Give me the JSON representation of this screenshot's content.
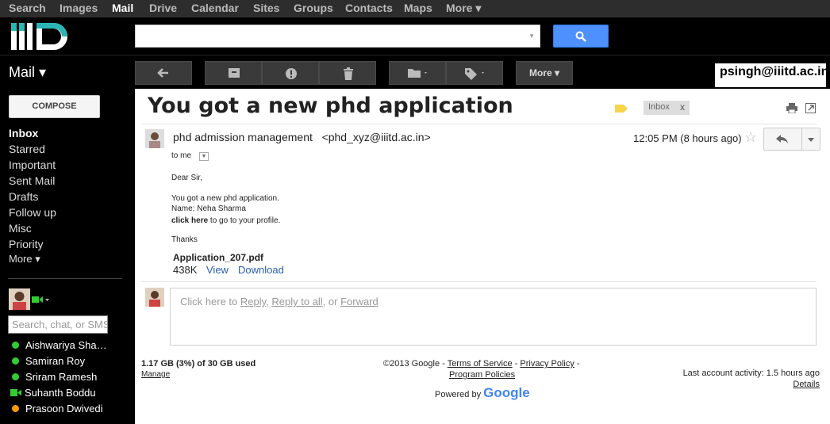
{
  "topnav": {
    "items": [
      "Search",
      "Images",
      "Mail",
      "Drive",
      "Calendar",
      "Sites",
      "Groups",
      "Contacts",
      "Maps",
      "More ▾"
    ]
  },
  "header": {
    "logo_text": "IIITD",
    "search_value": "",
    "search_caret": "▼"
  },
  "toolbar": {
    "mail_label": "Mail ▾",
    "more_label": "More ▾",
    "account_email": "psingh@iiitd.ac.in"
  },
  "sidebar": {
    "compose_label": "COMPOSE",
    "nav": [
      "Inbox",
      "Starred",
      "Important",
      "Sent Mail",
      "Drafts",
      "Follow up",
      "Misc",
      "Priority",
      "More ▾"
    ],
    "chat_search_placeholder": "Search, chat, or SMS",
    "contacts": [
      {
        "name": "Aishwariya Sha…",
        "status": "available"
      },
      {
        "name": "Samiran Roy",
        "status": "available"
      },
      {
        "name": "Sriram Ramesh",
        "status": "available"
      },
      {
        "name": "Suhanth Boddu",
        "status": "video"
      },
      {
        "name": "Prasoon Dwivedi",
        "status": "idle"
      }
    ],
    "status_colors": {
      "available": "#3c3",
      "idle": "#f90",
      "video": "#3c3"
    }
  },
  "message": {
    "subject": "You got a new phd application",
    "label": "Inbox",
    "label_close": "x",
    "sender_name": "phd admission management",
    "sender_email": "<phd_xyz@iiitd.ac.in>",
    "time": "12:05 PM (8 hours ago)",
    "to_line": "to me",
    "body": {
      "greeting": "Dear Sir,",
      "line1": "You got a new phd application.",
      "line2": "Name: Neha Sharma",
      "link_text": "click here",
      "link_suffix": " to go to your profile.",
      "signoff": "Thanks"
    },
    "attachment": {
      "name": "Application_207.pdf",
      "size": "438K",
      "view": "View",
      "download": "Download"
    }
  },
  "reply_box": {
    "prefix": "Click here to ",
    "reply": "Reply",
    "sep1": ", ",
    "reply_all": "Reply to all",
    "sep2": ", or ",
    "forward": "Forward"
  },
  "footer": {
    "storage": "1.17 GB (3%) of 30 GB used",
    "manage": "Manage",
    "copyright": "©2013 Google - ",
    "terms": "Terms of Service",
    "dash1": " - ",
    "privacy": "Privacy Policy",
    "dash2": " -",
    "program": "Program Policies",
    "powered_by": "Powered by",
    "google": "Google",
    "last_activity": "Last account activity: 1.5 hours ago",
    "details": "Details"
  },
  "colors": {
    "accent_blue": "#4d90fe",
    "link_blue": "#2a5db0",
    "label_yellow": "#f7d54a"
  }
}
